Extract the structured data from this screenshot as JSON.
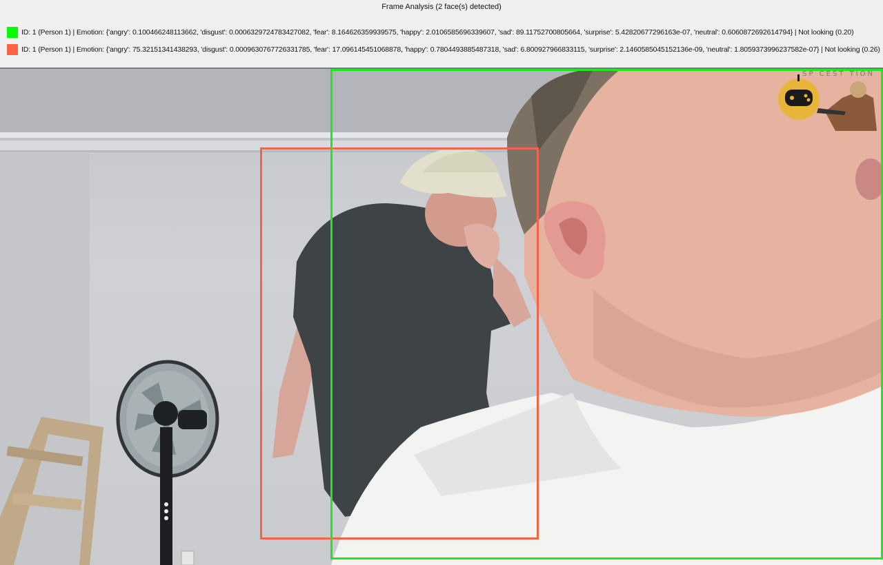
{
  "header": {
    "title": "Frame Analysis (2 face(s) detected)"
  },
  "detections": [
    {
      "color": "#00ff00",
      "text": "ID: 1 (Person 1) | Emotion: {'angry': 0.100466248113662, 'disgust': 0.0006329724783427082, 'fear': 8.164626359939575, 'happy': 2.0106585696339607, 'sad': 89.11752700805664, 'surprise': 5.42820677296163e-07, 'neutral': 0.6060872692614794} | Not looking (0.20)"
    },
    {
      "color": "#ff6347",
      "text": "ID: 1 (Person 1) | Emotion: {'angry': 75.32151341438293, 'disgust': 0.0009630767726331785, 'fear': 17.096145451068878, 'happy': 0.7804493885487318, 'sad': 6.800927966833115, 'surprise': 2.1460585045152136e-09, 'neutral': 1.8059373996237582e-07} | Not looking (0.26)"
    }
  ],
  "watermark": {
    "text": "SP CEST TION"
  },
  "colors": {
    "box_green": "#22e622",
    "box_red": "#f0654a",
    "panel_bg": "#f0f0f0"
  }
}
